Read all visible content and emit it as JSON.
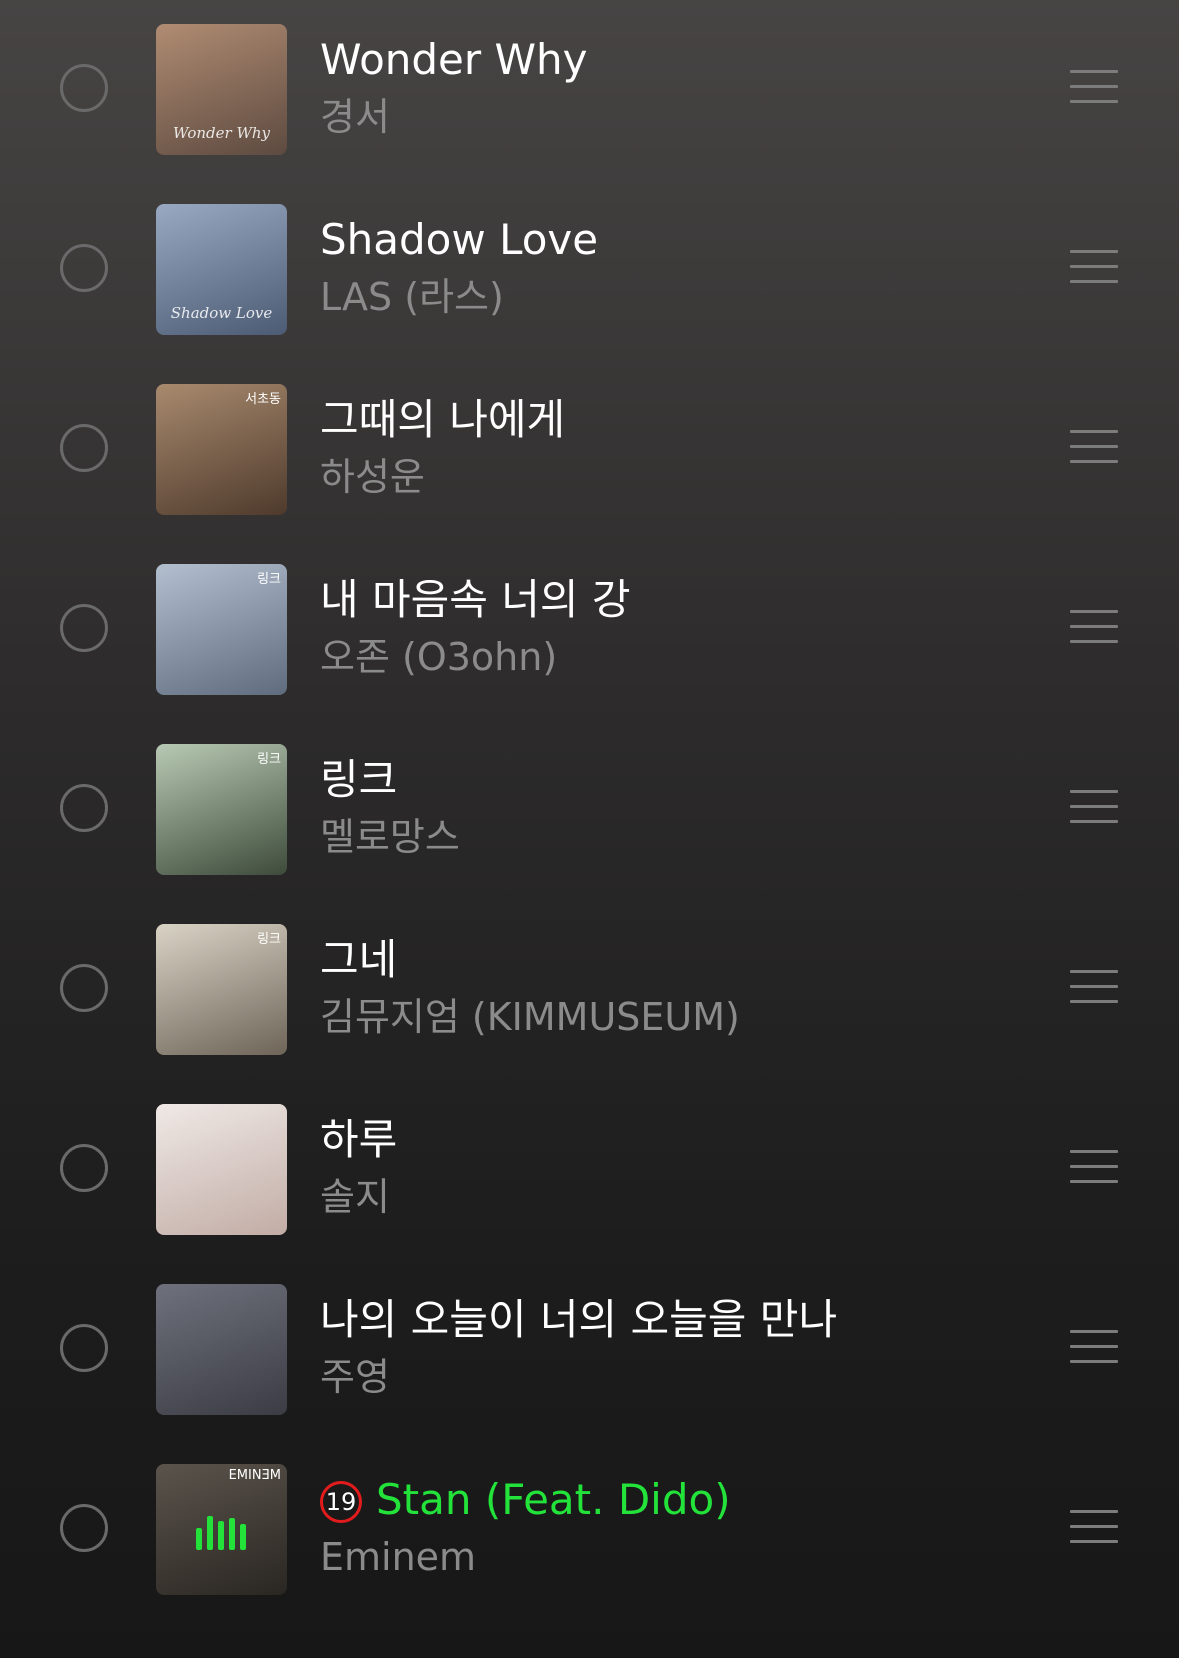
{
  "tracks": [
    {
      "title": "Wonder Why",
      "artist": "경서",
      "cover_caption": "Wonder Why",
      "cover_badge": "",
      "cover_colors": [
        "#b08c72",
        "#5d4a40"
      ],
      "explicit": false,
      "playing": false
    },
    {
      "title": "Shadow Love",
      "artist": "LAS (라스)",
      "cover_caption": "Shadow Love",
      "cover_badge": "",
      "cover_colors": [
        "#9aa9c2",
        "#4c5b74"
      ],
      "explicit": false,
      "playing": false
    },
    {
      "title": "그때의 나에게",
      "artist": "하성운",
      "cover_caption": "",
      "cover_badge": "서초동",
      "cover_colors": [
        "#a88a6e",
        "#4e3a2c"
      ],
      "explicit": false,
      "playing": false
    },
    {
      "title": "내 마음속 너의 강",
      "artist": "오존 (O3ohn)",
      "cover_caption": "",
      "cover_badge": "링크",
      "cover_colors": [
        "#b3bfcf",
        "#5f6c7e"
      ],
      "explicit": false,
      "playing": false
    },
    {
      "title": "링크",
      "artist": "멜로망스",
      "cover_caption": "",
      "cover_badge": "링크",
      "cover_colors": [
        "#b8c9b3",
        "#3e4b3b"
      ],
      "explicit": false,
      "playing": false
    },
    {
      "title": "그네",
      "artist": "김뮤지엄 (KIMMUSEUM)",
      "cover_caption": "",
      "cover_badge": "링크",
      "cover_colors": [
        "#d9d3c6",
        "#6e6558"
      ],
      "explicit": false,
      "playing": false
    },
    {
      "title": "하루",
      "artist": "솔지",
      "cover_caption": "",
      "cover_badge": "",
      "cover_colors": [
        "#efe9e6",
        "#c2aca5"
      ],
      "explicit": false,
      "playing": false
    },
    {
      "title": "나의 오늘이 너의 오늘을 만나",
      "artist": "주영",
      "cover_caption": "",
      "cover_badge": "",
      "cover_colors": [
        "#6e717c",
        "#3b3c44"
      ],
      "explicit": false,
      "playing": false
    },
    {
      "title": "Stan (Feat. Dido)",
      "artist": "Eminem",
      "cover_caption": "",
      "cover_badge": "EMINƎM",
      "cover_colors": [
        "#5b544c",
        "#2a2622"
      ],
      "explicit": true,
      "explicit_label": "19",
      "playing": true
    }
  ],
  "colors": {
    "accent_playing": "#23e23a",
    "explicit_ring": "#e21c1c",
    "title": "#ffffff",
    "artist": "#8b8b8b"
  },
  "icons": {
    "select": "circle-outline-icon",
    "drag": "drag-handle-icon",
    "playing": "equalizer-icon"
  },
  "playing_equalizer_levels": [
    0.65,
    1.0,
    0.85,
    0.95,
    0.75
  ]
}
